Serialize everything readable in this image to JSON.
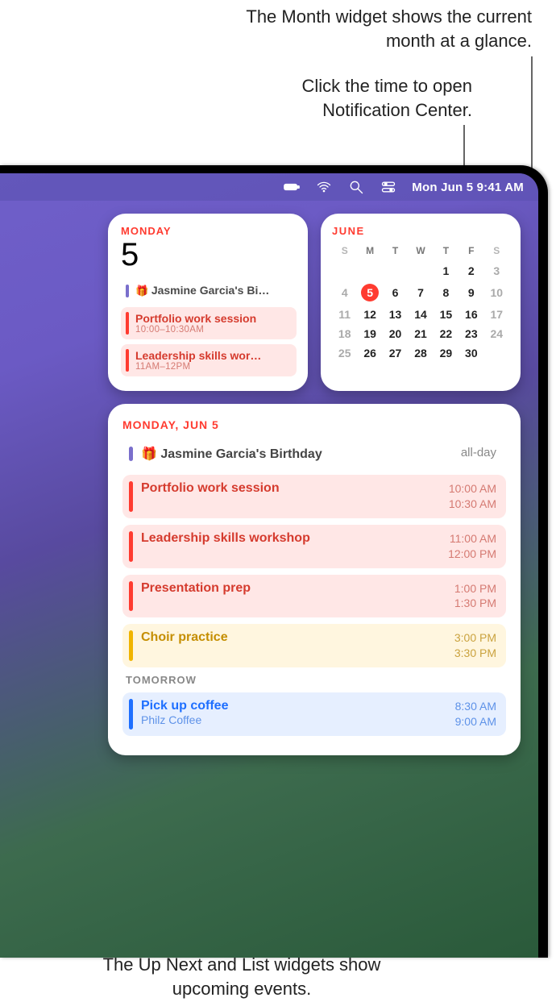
{
  "callouts": {
    "month": "The Month widget shows the current month at a glance.",
    "clock": "Click the time to open Notification Center.",
    "list": "The Up Next and List widgets show upcoming events."
  },
  "menubar": {
    "datetime": "Mon Jun 5  9:41 AM"
  },
  "upnext": {
    "weekday": "MONDAY",
    "day": "5",
    "events": [
      {
        "color": "purple",
        "icon": "gift",
        "title": "Jasmine Garcia's Bi…",
        "time": ""
      },
      {
        "color": "red",
        "title": "Portfolio work session",
        "time": "10:00–10:30AM"
      },
      {
        "color": "red",
        "title": "Leadership skills wor…",
        "time": "11AM–12PM"
      }
    ]
  },
  "month": {
    "label": "JUNE",
    "dow": [
      "S",
      "M",
      "T",
      "W",
      "T",
      "F",
      "S"
    ],
    "weeks": [
      [
        {
          "n": "",
          "out": true
        },
        {
          "n": "",
          "out": true
        },
        {
          "n": "",
          "out": true
        },
        {
          "n": "",
          "out": true
        },
        {
          "n": "1"
        },
        {
          "n": "2"
        },
        {
          "n": "3",
          "wk": true
        }
      ],
      [
        {
          "n": "4",
          "wk": true
        },
        {
          "n": "5",
          "sel": true
        },
        {
          "n": "6"
        },
        {
          "n": "7"
        },
        {
          "n": "8"
        },
        {
          "n": "9"
        },
        {
          "n": "10",
          "wk": true
        }
      ],
      [
        {
          "n": "11",
          "wk": true
        },
        {
          "n": "12"
        },
        {
          "n": "13"
        },
        {
          "n": "14"
        },
        {
          "n": "15"
        },
        {
          "n": "16"
        },
        {
          "n": "17",
          "wk": true
        }
      ],
      [
        {
          "n": "18",
          "wk": true
        },
        {
          "n": "19"
        },
        {
          "n": "20"
        },
        {
          "n": "21"
        },
        {
          "n": "22"
        },
        {
          "n": "23"
        },
        {
          "n": "24",
          "wk": true
        }
      ],
      [
        {
          "n": "25",
          "wk": true
        },
        {
          "n": "26"
        },
        {
          "n": "27"
        },
        {
          "n": "28"
        },
        {
          "n": "29"
        },
        {
          "n": "30"
        },
        {
          "n": "",
          "out": true
        }
      ]
    ]
  },
  "list": {
    "header": "MONDAY, JUN 5",
    "today": [
      {
        "color": "purple",
        "icon": "gift",
        "title": "Jasmine Garcia's Birthday",
        "allday": "all-day"
      },
      {
        "color": "red",
        "title": "Portfolio work session",
        "start": "10:00 AM",
        "end": "10:30 AM"
      },
      {
        "color": "red",
        "title": "Leadership skills workshop",
        "start": "11:00 AM",
        "end": "12:00 PM"
      },
      {
        "color": "red",
        "title": "Presentation prep",
        "start": "1:00 PM",
        "end": "1:30 PM"
      },
      {
        "color": "yellow",
        "title": "Choir practice",
        "start": "3:00 PM",
        "end": "3:30 PM"
      }
    ],
    "section2": "TOMORROW",
    "tomorrow": [
      {
        "color": "blue",
        "title": "Pick up coffee",
        "sub": "Philz Coffee",
        "start": "8:30 AM",
        "end": "9:00 AM"
      }
    ]
  }
}
